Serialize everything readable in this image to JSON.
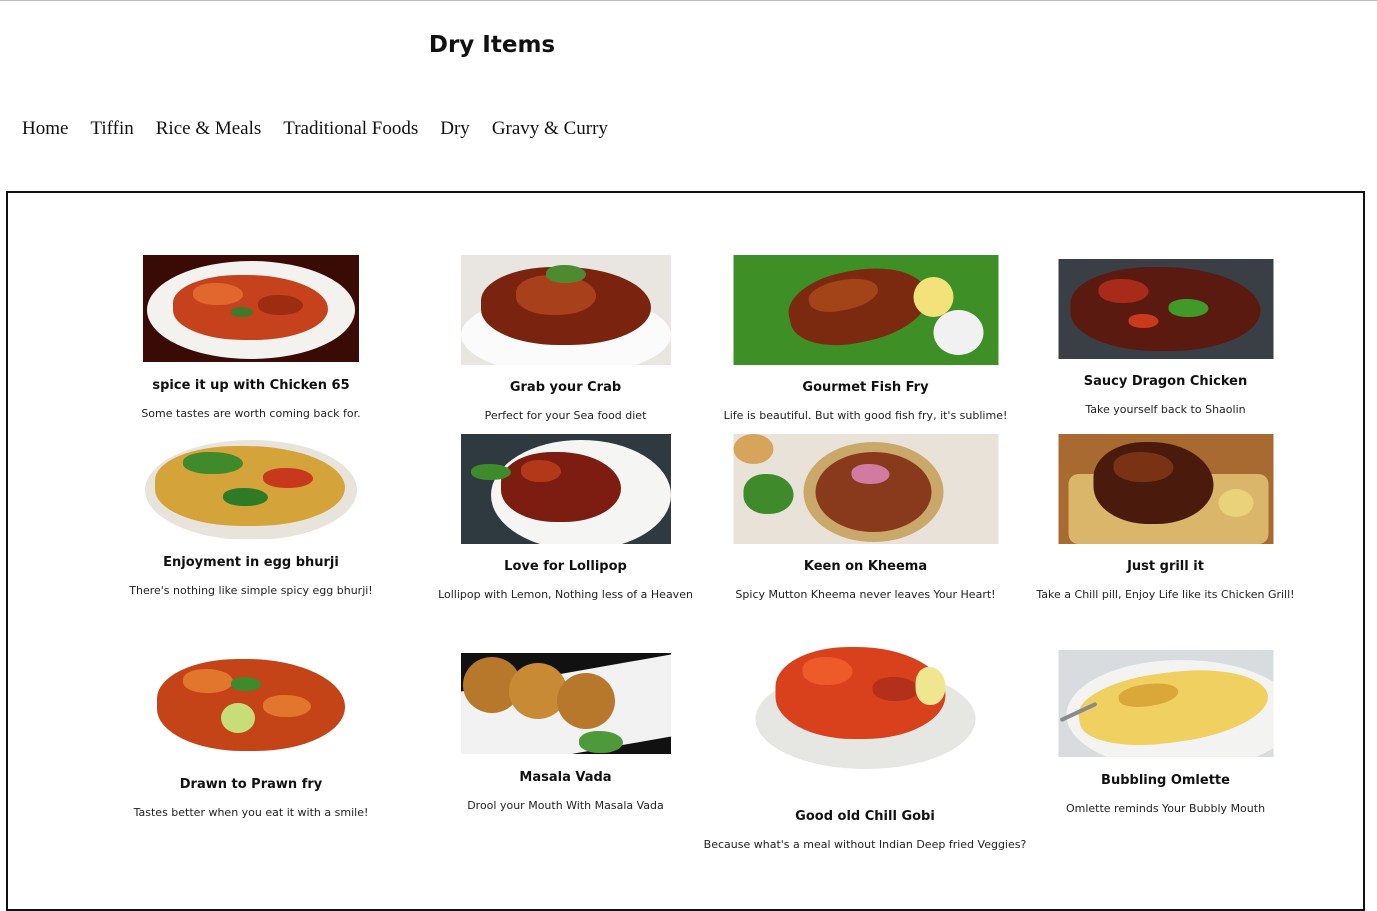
{
  "page": {
    "title": "Dry Items"
  },
  "nav": {
    "items": [
      "Home",
      "Tiffin",
      "Rice & Meals",
      "Traditional Foods",
      "Dry",
      "Gravy & Curry"
    ]
  },
  "dishes": [
    {
      "name": "spice it up with Chicken 65",
      "tagline": "Some tastes are worth coming back for."
    },
    {
      "name": "Grab your Crab",
      "tagline": "Perfect for your Sea food diet"
    },
    {
      "name": "Gourmet Fish Fry",
      "tagline": "Life is beautiful. But with good fish fry, it's sublime!"
    },
    {
      "name": "Saucy Dragon Chicken",
      "tagline": "Take yourself back to Shaolin"
    },
    {
      "name": "Enjoyment in egg bhurji",
      "tagline": "There's nothing like simple spicy egg bhurji!"
    },
    {
      "name": "Love for Lollipop",
      "tagline": "Lollipop with Lemon, Nothing less of a Heaven"
    },
    {
      "name": "Keen on Kheema",
      "tagline": "Spicy Mutton Kheema never leaves Your Heart!"
    },
    {
      "name": "Just grill it",
      "tagline": "Take a Chill pill, Enjoy Life like its Chicken Grill!"
    },
    {
      "name": "Drawn to Prawn fry",
      "tagline": "Tastes better when you eat it with a smile!"
    },
    {
      "name": "Masala Vada",
      "tagline": "Drool your Mouth With Masala Vada"
    },
    {
      "name": "Good old Chill Gobi",
      "tagline": "Because what's a meal without Indian Deep fried Veggies?"
    },
    {
      "name": "Bubbling Omlette",
      "tagline": "Omlette reminds Your Bubbly Mouth"
    }
  ]
}
